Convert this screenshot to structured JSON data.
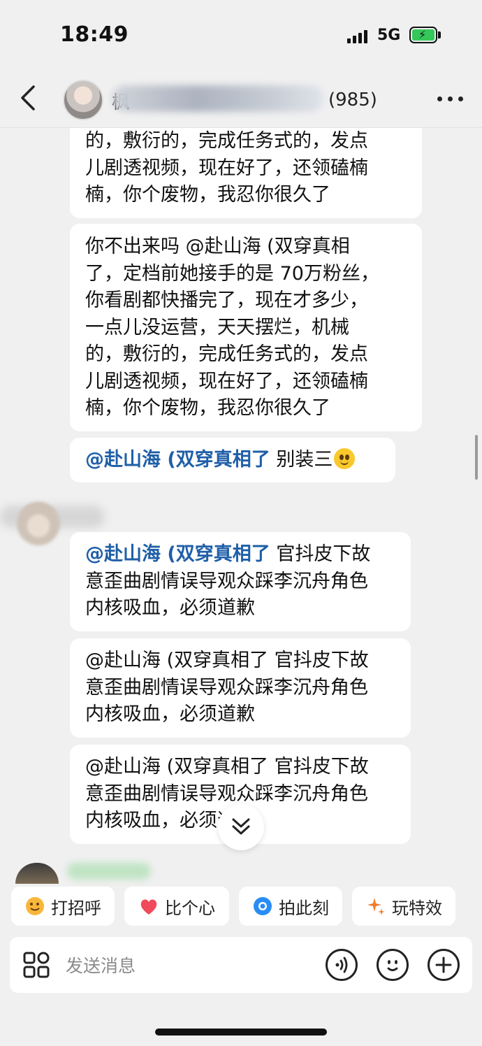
{
  "status_bar": {
    "time": "18:49",
    "network": "5G"
  },
  "header": {
    "group_name": "枫",
    "member_count": "(985)"
  },
  "messages": {
    "partial_top": [
      "的，敷衍的，完成任务式的，发点",
      "儿剧透视频，现在好了，还领磕楠",
      "楠，你个废物，我忍你很久了"
    ],
    "long": [
      "你不出来吗 @赴山海 (双穿真相",
      "了，定档前她接手的是 70万粉丝，",
      "你看剧都快播完了，现在才多少，",
      "一点儿没运营，天天摆烂，机械",
      "的，敷衍的，完成任务式的，发点",
      "儿剧透视频，现在好了，还领磕楠",
      "楠，你个废物，我忍你很久了"
    ],
    "short_mention": "@赴山海 (双穿真相了",
    "short_text": " 别装三",
    "apology_mention": "@赴山海 (双穿真相了",
    "apology_lines": [
      " 官抖皮下故",
      "意歪曲剧情误导观众踩李沉舟角色",
      "内核吸血，必须道歉"
    ],
    "apology_plain": [
      "@赴山海 (双穿真相了 官抖皮下故",
      "意歪曲剧情误导观众踩李沉舟角色",
      "内核吸血，必须道歉"
    ],
    "apology_plain_3": [
      "@赴山海 (双穿真相了 官抖皮下故",
      "意歪曲剧情误导观众踩李沉舟角色",
      "内核吸血，必须道歉"
    ]
  },
  "quick_actions": [
    "打招呼",
    "比个心",
    "拍此刻",
    "玩特效"
  ],
  "input": {
    "placeholder": "发送消息"
  },
  "colors": {
    "mention": "#1f5fa8",
    "background": "#f0f0f0"
  }
}
